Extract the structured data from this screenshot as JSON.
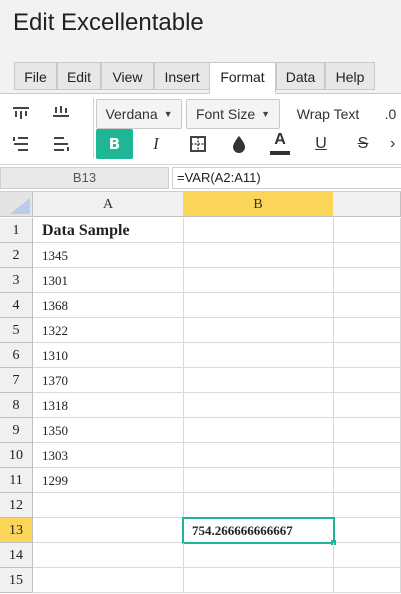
{
  "app": {
    "title": "Edit Excellentable"
  },
  "menu_tabs": [
    "File",
    "Edit",
    "View",
    "Insert",
    "Format",
    "Data",
    "Help"
  ],
  "active_tab": "Format",
  "toolbar": {
    "font_family": "Verdana",
    "font_size": "Font Size",
    "wrap_text": "Wrap Text",
    "decimal": ".0",
    "bold": "B",
    "italic": "I",
    "underline": "U",
    "strikethrough": "S",
    "more": "›",
    "text_color_accent": "#333333",
    "accent_color": "#1fb696",
    "icons": [
      "align-top-icon",
      "align-middle-icon",
      "align-left-indent-icon",
      "align-right-indent-icon",
      "borders-icon",
      "fill-color-icon",
      "text-color-icon"
    ]
  },
  "formula_bar": {
    "cell_ref": "B13",
    "formula": "=VAR(A2:A11)"
  },
  "sheet": {
    "columns": [
      "A",
      "B"
    ],
    "selected_column": "B",
    "selected_row": 13,
    "row_numbers": [
      "1",
      "2",
      "3",
      "4",
      "5",
      "6",
      "7",
      "8",
      "9",
      "10",
      "11",
      "12",
      "13",
      "14",
      "15"
    ],
    "cells_a": [
      "Data Sample",
      "1345",
      "1301",
      "1368",
      "1322",
      "1310",
      "1370",
      "1318",
      "1350",
      "1303",
      "1299",
      "",
      "",
      "",
      ""
    ],
    "cells_b": [
      "",
      "",
      "",
      "",
      "",
      "",
      "",
      "",
      "",
      "",
      "",
      "",
      "754.266666666667",
      "",
      ""
    ],
    "selection_color": "#1fb696",
    "header_highlight": "#fbd559"
  }
}
